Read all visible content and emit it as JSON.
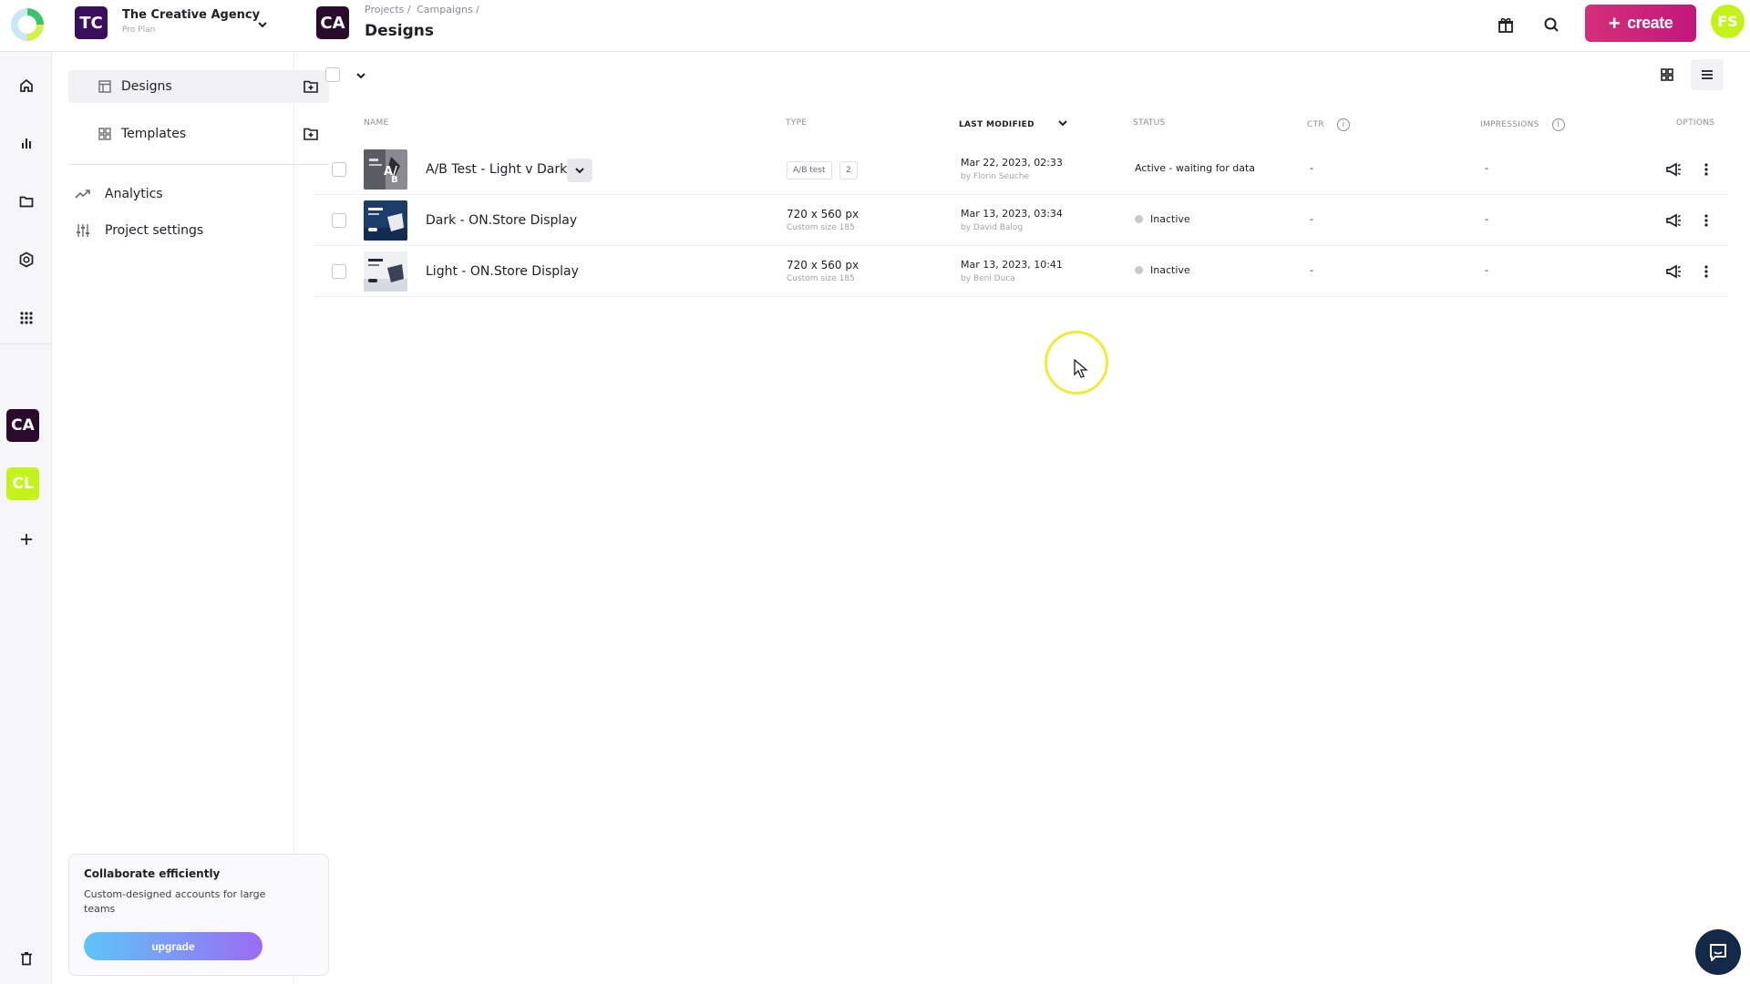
{
  "topbar": {
    "org_initials": "TC",
    "org_name": "The Creative Agency",
    "org_plan": "Pro Plan",
    "project_initials": "CA",
    "breadcrumb": [
      "Projects /",
      "Campaigns /"
    ],
    "page_title": "Designs",
    "create_label": "create",
    "user_initials": "FS"
  },
  "rail": {
    "items": [
      {
        "icon": "home-icon"
      },
      {
        "icon": "bar-chart-icon"
      },
      {
        "icon": "folder-icon"
      },
      {
        "icon": "brand-kit-icon"
      },
      {
        "icon": "apps-grid-icon"
      }
    ],
    "workspaces": [
      "CA",
      "CL"
    ]
  },
  "sidebar": {
    "designs_label": "Designs",
    "templates_label": "Templates",
    "analytics_label": "Analytics",
    "settings_label": "Project settings",
    "upsell": {
      "title": "Collaborate efficiently",
      "text": "Custom-designed accounts for large teams",
      "button": "upgrade"
    }
  },
  "table": {
    "headers": {
      "name": "NAME",
      "type": "TYPE",
      "modified": "LAST MODIFIED",
      "status": "STATUS",
      "ctr": "CTR",
      "impressions": "IMPRESSIONS",
      "options": "OPTIONS"
    },
    "rows": [
      {
        "name": "A/B Test - Light v Dark",
        "type_tag": "A/B test",
        "type_count": "2",
        "date": "Mar 22, 2023, 02:33",
        "by": "by Florin Seuche",
        "status": "Active - waiting for data",
        "ctr": "-",
        "impressions": "-"
      },
      {
        "name": "Dark - ON.Store Display",
        "type": "720 x 560 px",
        "type_sub": "Custom size 185",
        "date": "Mar 13, 2023, 03:34",
        "by": "by David Balog",
        "status": "Inactive",
        "ctr": "-",
        "impressions": "-"
      },
      {
        "name": "Light - ON.Store Display",
        "type": "720 x 560 px",
        "type_sub": "Custom size 185",
        "date": "Mar 13, 2023, 10:41",
        "by": "by Beni Duca",
        "status": "Inactive",
        "ctr": "-",
        "impressions": "-"
      }
    ]
  },
  "colors": {
    "create_button": "#c2177c",
    "org_avatar": "#3a0f5e",
    "project_avatar": "#2a0b2c",
    "user_avatar": "#c4f31a",
    "chat_button": "#14284a"
  }
}
